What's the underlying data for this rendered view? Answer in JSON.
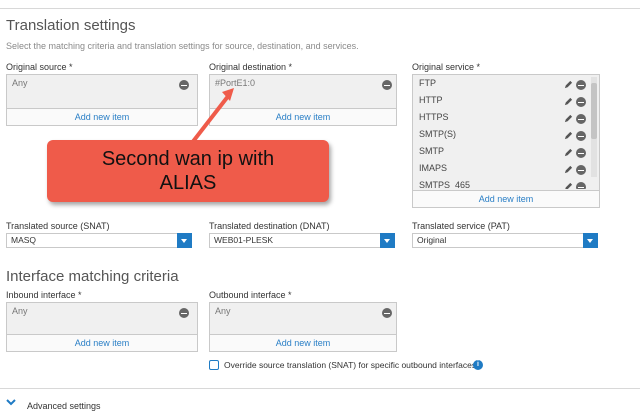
{
  "translation": {
    "title": "Translation settings",
    "description": "Select the matching criteria and translation settings for source, destination, and services.",
    "original_source": {
      "label": "Original source *",
      "items": [
        "Any"
      ],
      "add_label": "Add new item"
    },
    "original_destination": {
      "label": "Original destination *",
      "items": [
        "#PortE1:0"
      ],
      "add_label": "Add new item"
    },
    "original_service": {
      "label": "Original service *",
      "items": [
        "FTP",
        "HTTP",
        "HTTPS",
        "SMTP(S)",
        "SMTP",
        "IMAPS",
        "SMTPS_465"
      ],
      "add_label": "Add new item"
    },
    "translated_source": {
      "label": "Translated source (SNAT)",
      "value": "MASQ"
    },
    "translated_destination": {
      "label": "Translated destination (DNAT)",
      "value": "WEB01-PLESK"
    },
    "translated_service": {
      "label": "Translated service (PAT)",
      "value": "Original"
    }
  },
  "interface": {
    "title": "Interface matching criteria",
    "inbound": {
      "label": "Inbound interface *",
      "items": [
        "Any"
      ],
      "add_label": "Add new item"
    },
    "outbound": {
      "label": "Outbound interface *",
      "items": [
        "Any"
      ],
      "add_label": "Add new item"
    },
    "override_label": "Override source translation (SNAT) for specific outbound interfaces",
    "info_glyph": "i"
  },
  "advanced": {
    "label": "Advanced settings"
  },
  "callout": {
    "line1": "Second wan ip with",
    "line2": "ALIAS"
  },
  "colors": {
    "accent": "#1f7bc4",
    "link": "#2a7fc6",
    "callout": "#ef5b4a"
  }
}
